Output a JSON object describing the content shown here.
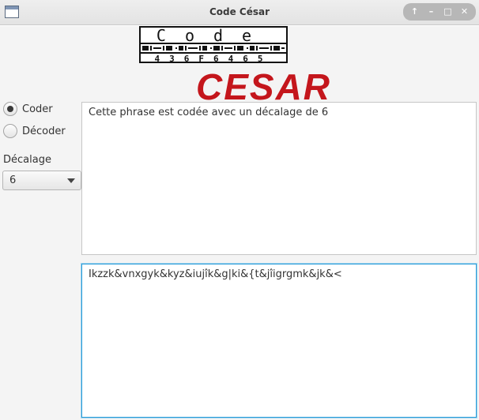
{
  "window": {
    "title": "Code César",
    "controls": {
      "restore": "↑",
      "minimize": "–",
      "maximize": "□",
      "close": "✕"
    }
  },
  "logo": {
    "code_text": "Code",
    "hex_text": "436F6465",
    "cesar_text": "CESAR",
    "cesar_color": "#c4161c"
  },
  "options": {
    "coder_label": "Coder",
    "decoder_label": "Décoder",
    "selected": "Coder"
  },
  "shift": {
    "label": "Décalage",
    "value": "6"
  },
  "input_text": "Cette phrase est codée avec un décalage de 6",
  "output_text": "Ikzzk&vnxgyk&kyz&iujîk&g|ki&{t&jîigrgmk&jk&<"
}
